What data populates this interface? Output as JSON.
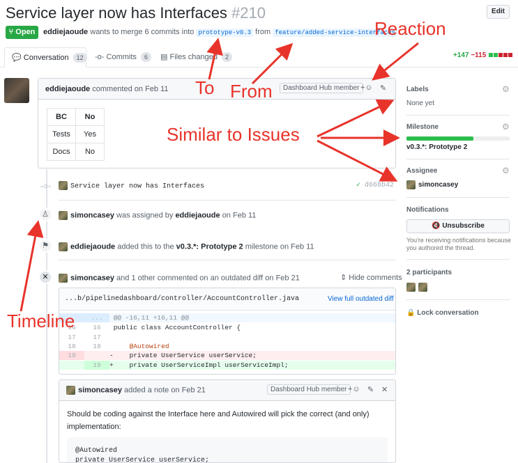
{
  "pr": {
    "title": "Service layer now has Interfaces",
    "number": "#210",
    "edit_label": "Edit",
    "state": "Open",
    "author": "eddiejaoude",
    "merge_text": "wants to merge 6 commits into",
    "base_branch": "prototype-v0.3",
    "from_text": "from",
    "head_branch": "feature/added-service-interfaces"
  },
  "tabs": [
    {
      "label": "Conversation",
      "count": "12"
    },
    {
      "label": "Commits",
      "count": "6"
    },
    {
      "label": "Files changed",
      "count": "2"
    }
  ],
  "diffstat": {
    "additions": "+147",
    "deletions": "−115"
  },
  "comment": {
    "author": "eddiejaoude",
    "action": "commented on Feb 11",
    "badge": "Dashboard Hub member",
    "table": {
      "headers": [
        "BC",
        "No"
      ],
      "rows": [
        [
          "Tests",
          "Yes"
        ],
        [
          "Docs",
          "No"
        ]
      ]
    }
  },
  "timeline": {
    "commit_message": "Service layer now has Interfaces",
    "commit_sha": "d668b42",
    "assigned_user": "simoncasey",
    "assigned_text": "was assigned by",
    "assigned_by": "eddiejaoude",
    "assigned_date": "on Feb 11",
    "milestone_user": "eddiejaoude",
    "milestone_text": "added this to the",
    "milestone_name": "v0.3.*: Prototype 2",
    "milestone_suffix": "milestone on Feb 11",
    "outdated_user": "simoncasey",
    "outdated_text": "and 1 other commented on an outdated diff on Feb 21",
    "hide_comments": "Hide comments"
  },
  "diff": {
    "file_path": "...b/pipelinedashboard/controller/AccountController.java",
    "view_label": "View full outdated diff",
    "hunk": "@@ -16,11 +16,11 @@",
    "lines": [
      {
        "old": "16",
        "new": "16",
        "code": " public class AccountController {",
        "kind": "ctx"
      },
      {
        "old": "17",
        "new": "17",
        "code": "",
        "kind": "ctx"
      },
      {
        "old": "18",
        "new": "18",
        "code": "     @Autowired",
        "kind": "ctx"
      },
      {
        "old": "19",
        "new": "",
        "code": "-    private UserService userService;",
        "kind": "del"
      },
      {
        "old": "",
        "new": "19",
        "code": "+    private UserServiceImpl userServiceImpl;",
        "kind": "add"
      }
    ]
  },
  "note": {
    "author": "simoncasey",
    "action": "added a note on Feb 21",
    "badge": "Dashboard Hub member",
    "body": "Should be coding against the Interface here and Autowired will pick the correct (and only) implementation:",
    "code_line1": "@Autowired",
    "code_line2": "private UserService userService;"
  },
  "sidebar": {
    "labels_title": "Labels",
    "labels_value": "None yet",
    "milestone_title": "Milestone",
    "milestone_value": "v0.3.*: Prototype 2",
    "milestone_progress": 0.65,
    "assignee_title": "Assignee",
    "assignee_value": "simoncasey",
    "notifications_title": "Notifications",
    "unsubscribe_label": "Unsubscribe",
    "notif_text": "You're receiving notifications because you authored the thread.",
    "participants_title": "2 participants",
    "lock_label": "Lock conversation"
  },
  "annotations": {
    "reaction": "Reaction",
    "to": "To",
    "from": "From",
    "similar": "Similar to Issues",
    "timeline": "Timeline"
  },
  "colors": {
    "open_green": "#28a745",
    "annotation_red": "#e8332a",
    "link_blue": "#0366d6",
    "diff_del_bg": "#ffeef0",
    "diff_add_bg": "#e6ffed"
  }
}
